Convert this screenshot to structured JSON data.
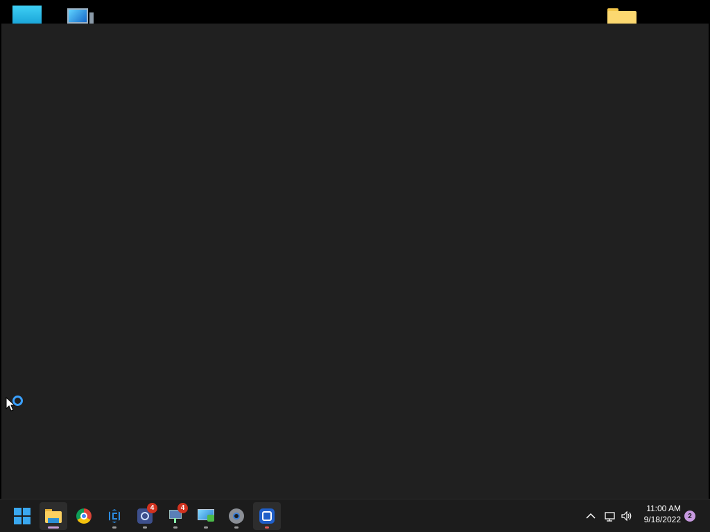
{
  "desktop": {
    "icons": [
      "tile-icon",
      "this-pc-icon",
      "folder-icon"
    ]
  },
  "window": {
    "state": "loading"
  },
  "taskbar": {
    "apps": [
      {
        "name": "start",
        "icon": "windows-logo-icon"
      },
      {
        "name": "file-explorer",
        "icon": "folder-icon",
        "active": true
      },
      {
        "name": "chrome",
        "icon": "chrome-icon"
      },
      {
        "name": "visual-studio",
        "icon": "visual-studio-icon"
      },
      {
        "name": "app-gear",
        "icon": "gear-app-icon",
        "badge": "4"
      },
      {
        "name": "network-app",
        "icon": "network-icon",
        "badge": "4"
      },
      {
        "name": "remote-desktop",
        "icon": "monitor-icon"
      },
      {
        "name": "settings",
        "icon": "settings-icon"
      },
      {
        "name": "snipping-tool",
        "icon": "snip-icon"
      }
    ],
    "tray": {
      "chevron": "^",
      "time": "11:00 AM",
      "date": "9/18/2022",
      "notifications": "2"
    }
  }
}
